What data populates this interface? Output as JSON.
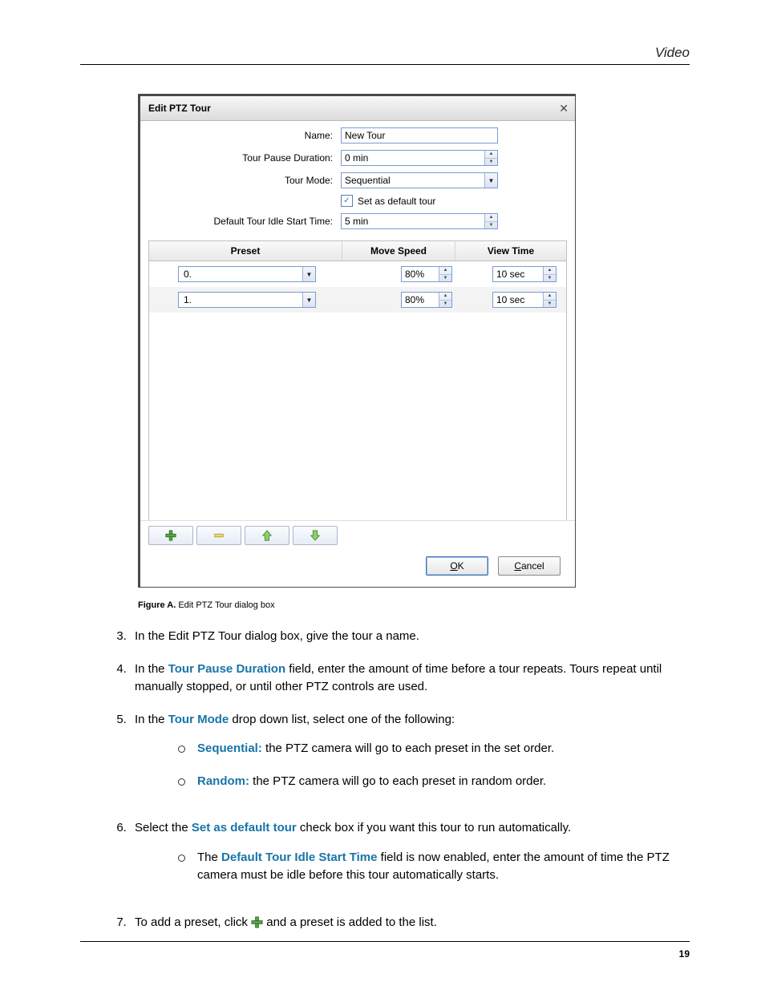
{
  "header_section": "Video",
  "dialog": {
    "title": "Edit PTZ Tour",
    "labels": {
      "name": "Name:",
      "pause": "Tour Pause Duration:",
      "mode": "Tour Mode:",
      "default_chk": "Set as default tour",
      "idle": "Default Tour Idle Start Time:"
    },
    "values": {
      "name": "New Tour",
      "pause": "0 min",
      "mode": "Sequential",
      "default_checked": "✓",
      "idle": "5 min"
    },
    "columns": {
      "preset": "Preset",
      "move": "Move Speed",
      "view": "View Time"
    },
    "rows": [
      {
        "preset": "0.",
        "move": "80%",
        "view": "10 sec"
      },
      {
        "preset": "1.",
        "move": "80%",
        "view": "10 sec"
      }
    ],
    "buttons": {
      "ok": "OK",
      "cancel": "Cancel"
    }
  },
  "caption": {
    "label": "Figure A.",
    "text": "Edit PTZ Tour dialog box"
  },
  "steps": {
    "s3": "In the Edit PTZ Tour dialog box, give the tour a name.",
    "s4a": "In the ",
    "s4kw": "Tour Pause Duration",
    "s4b": " field, enter the amount of time before a tour repeats. Tours repeat until manually stopped, or until other PTZ controls are used.",
    "s5a": "In the ",
    "s5kw": "Tour Mode",
    "s5b": " drop down list, select one of the following:",
    "s5o1kw": "Sequential:",
    "s5o1": " the PTZ camera will go to each preset in the set order.",
    "s5o2kw": "Random:",
    "s5o2": " the PTZ camera will go to each preset in random order.",
    "s6a": "Select the ",
    "s6kw": "Set as default tour",
    "s6b": " check box if you want this tour to run automatically.",
    "s6subA": "The ",
    "s6subKw": "Default Tour Idle Start Time",
    "s6subB": " field is now enabled, enter the amount of time the PTZ camera must be idle before this tour automatically starts.",
    "s7a": "To add a preset, click ",
    "s7b": " and a preset is added to the list."
  },
  "page_number": "19"
}
